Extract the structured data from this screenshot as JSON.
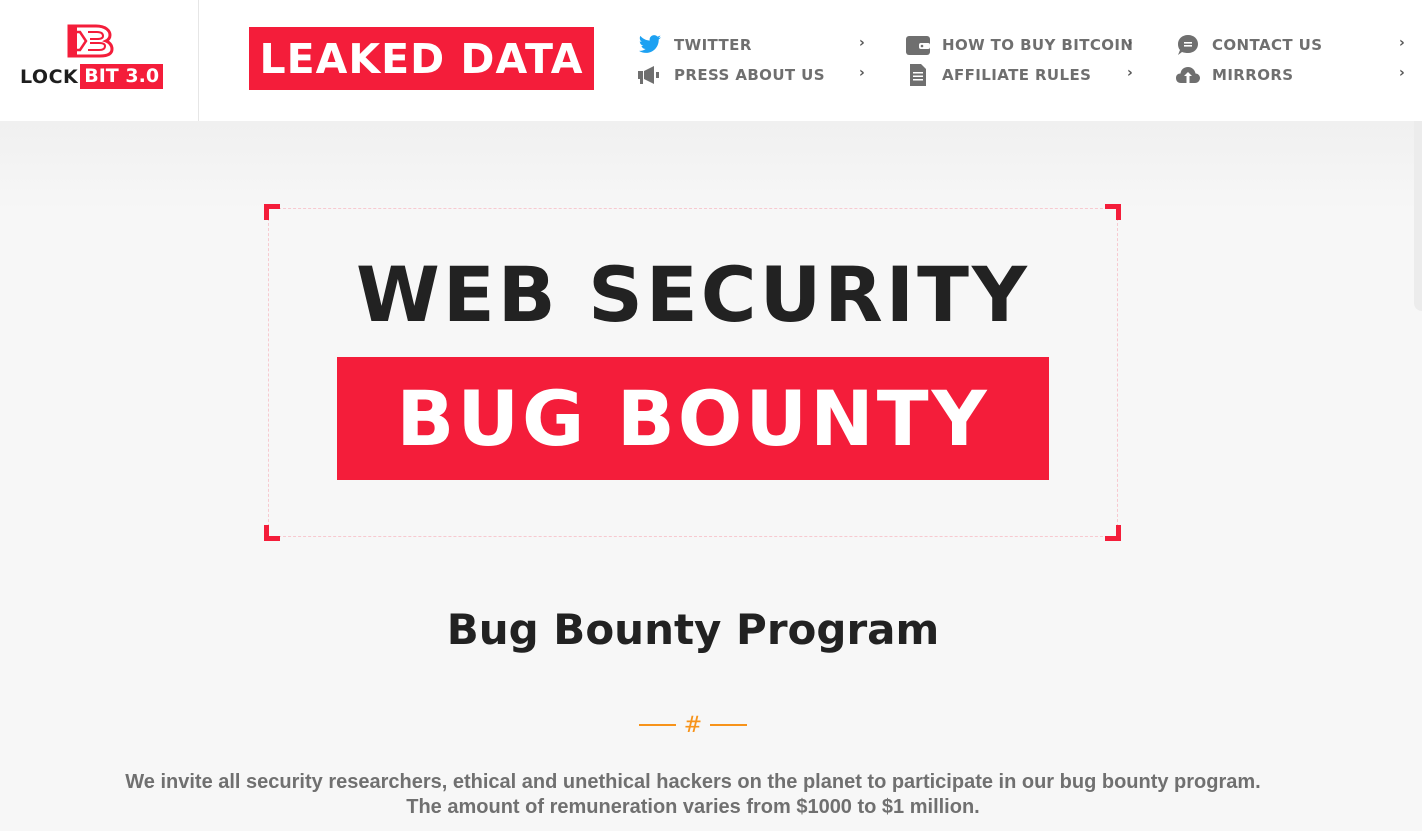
{
  "header": {
    "logo": {
      "word_lock": "LOCK",
      "word_bit": "BIT 3.0",
      "icon": "lockbit-b-icon"
    },
    "leaked_button": "LEAKED DATA",
    "nav": [
      {
        "label": "TWITTER",
        "icon": "twitter-icon",
        "icon_color": "#1da1f2"
      },
      {
        "label": "PRESS ABOUT US",
        "icon": "megaphone-icon"
      },
      {
        "label": "HOW TO BUY BITCOIN",
        "icon": "wallet-icon"
      },
      {
        "label": "AFFILIATE RULES",
        "icon": "document-icon"
      },
      {
        "label": "CONTACT US",
        "icon": "chat-bubble-icon"
      },
      {
        "label": "MIRRORS",
        "icon": "cloud-upload-icon"
      }
    ],
    "chevron": "›"
  },
  "hero": {
    "title": "WEB SECURITY",
    "banner": "BUG BOUNTY"
  },
  "section": {
    "title": "Bug Bounty Program",
    "divider_symbol": "#",
    "intro_line1": "We invite all security researchers, ethical and unethical hackers on the planet to participate in our bug bounty program.",
    "intro_line2": "The amount of remuneration varies from $1000 to $1 million."
  },
  "colors": {
    "brand_red": "#f41d3a",
    "accent_orange": "#f7931a",
    "nav_text": "#6f6f6f",
    "twitter_blue": "#1da1f2"
  }
}
